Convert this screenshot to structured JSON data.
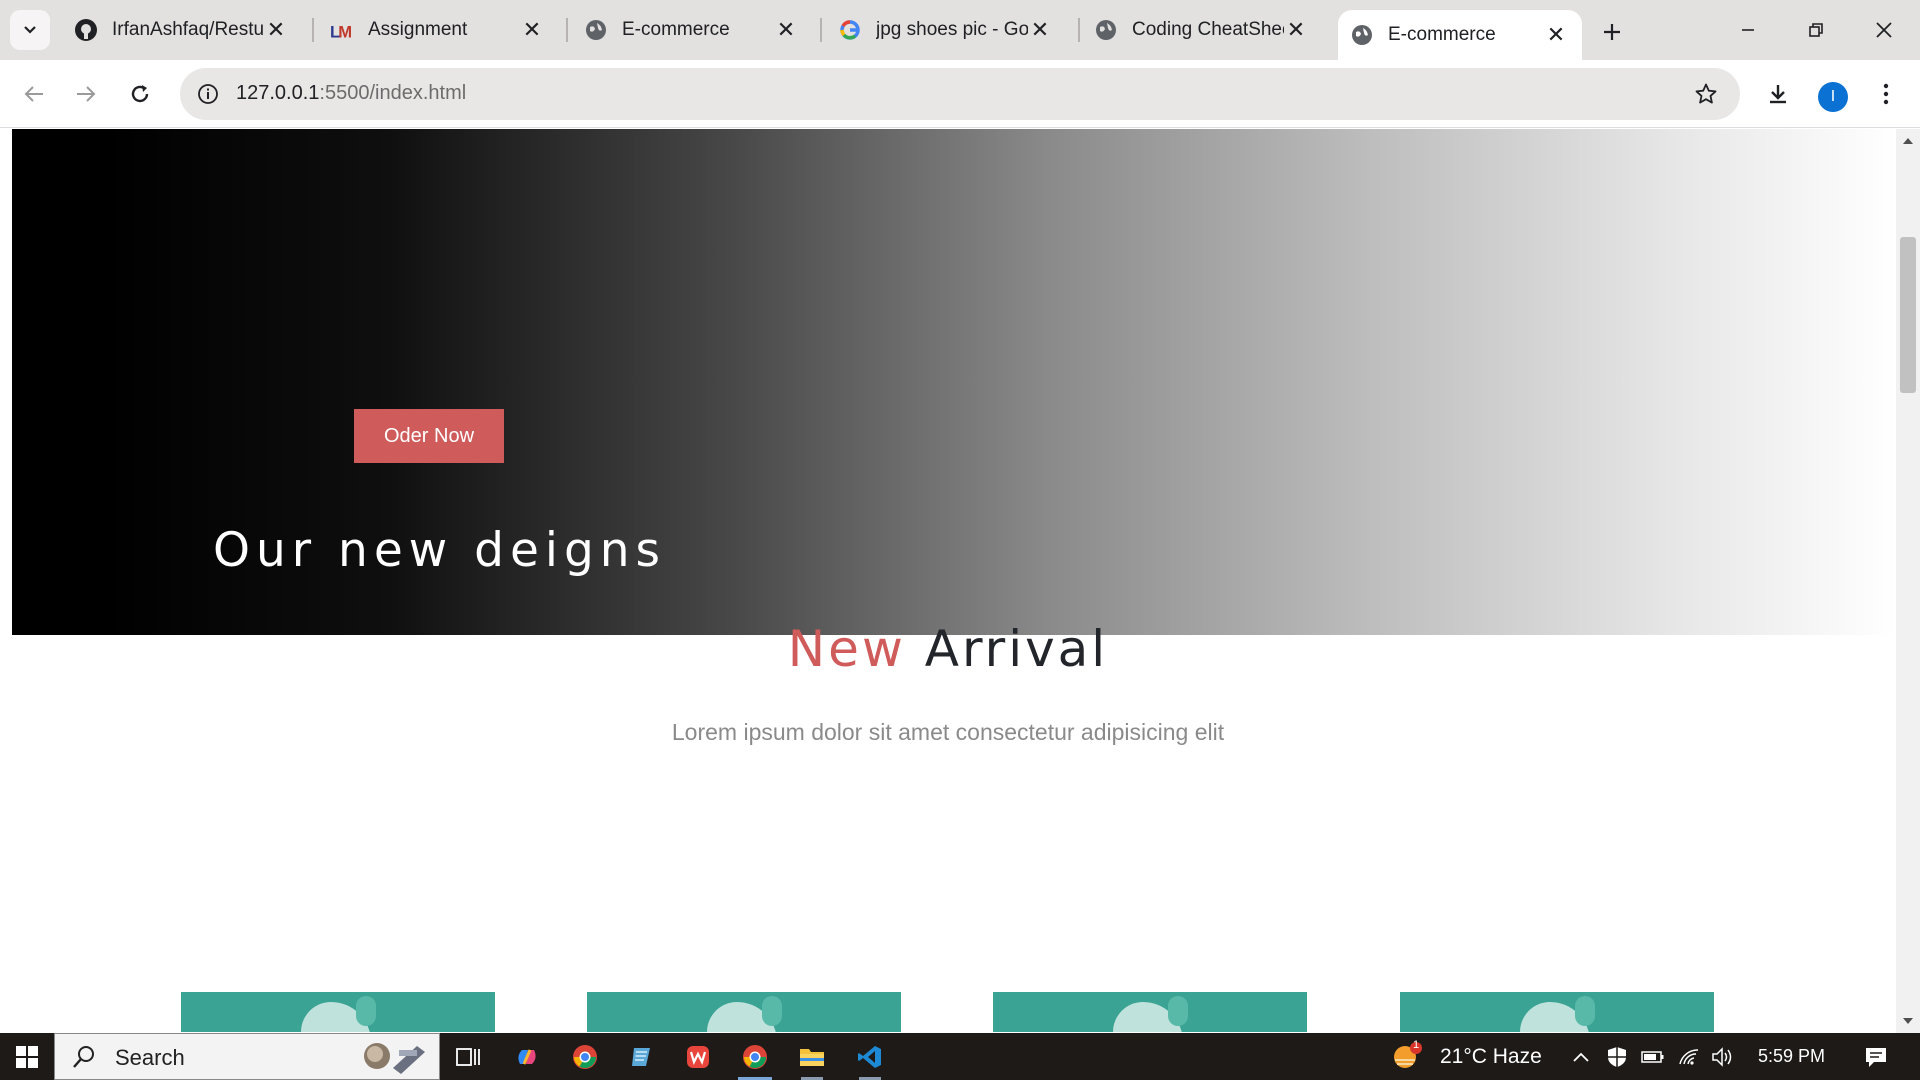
{
  "browser": {
    "tabs": [
      {
        "title": "IrfanAshfaq/Restur",
        "icon": "github-icon",
        "active": false
      },
      {
        "title": "Assignment",
        "icon": "lms-icon",
        "active": false
      },
      {
        "title": "E-commerce",
        "icon": "globe-icon",
        "active": false
      },
      {
        "title": "jpg shoes pic - Goo",
        "icon": "google-icon",
        "active": false
      },
      {
        "title": "Coding CheatShee",
        "icon": "globe-icon",
        "active": false
      },
      {
        "title": "E-commerce",
        "icon": "globe-icon",
        "active": true
      }
    ],
    "address": {
      "host": "127.0.0.1",
      "rest": ":5500/index.html"
    },
    "profile_initial": "I"
  },
  "page": {
    "hero": {
      "button_label": "Oder Now",
      "title": "Our new deigns"
    },
    "arrival": {
      "title_accent": "New",
      "title_rest": "Arrival",
      "subtitle": "Lorem ipsum dolor sit amet consectetur adipisicing elit"
    },
    "colors": {
      "accent": "#cf5b5b",
      "card": "#3aa393"
    }
  },
  "taskbar": {
    "search_label": "Search",
    "weather": "21°C  Haze",
    "weather_badge": "1",
    "time": "5:59 PM"
  }
}
